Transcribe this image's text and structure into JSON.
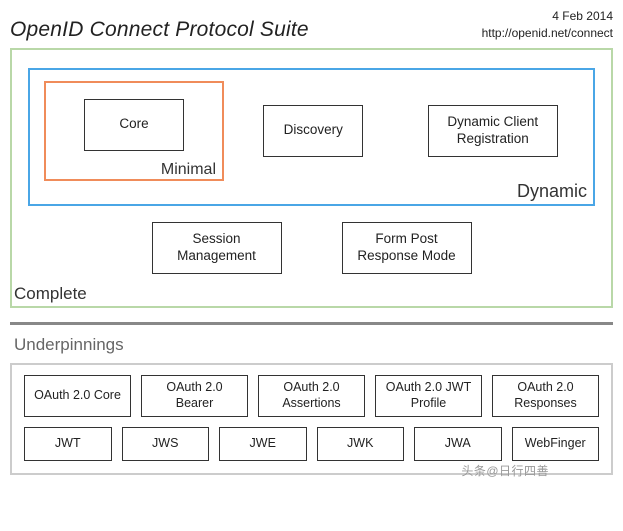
{
  "header": {
    "title": "OpenID Connect Protocol Suite",
    "date": "4 Feb 2014",
    "url": "http://openid.net/connect"
  },
  "groups": {
    "complete": "Complete",
    "dynamic": "Dynamic",
    "minimal": "Minimal"
  },
  "specs": {
    "core": "Core",
    "discovery": "Discovery",
    "dcr": "Dynamic Client Registration",
    "session": "Session Management",
    "formpost": "Form Post Response Mode"
  },
  "underpinnings": {
    "title": "Underpinnings",
    "row1": [
      "OAuth 2.0 Core",
      "OAuth 2.0 Bearer",
      "OAuth 2.0 Assertions",
      "OAuth 2.0 JWT Profile",
      "OAuth 2.0 Responses"
    ],
    "row2": [
      "JWT",
      "JWS",
      "JWE",
      "JWK",
      "JWA",
      "WebFinger"
    ]
  },
  "watermark": "头条@日行四善"
}
